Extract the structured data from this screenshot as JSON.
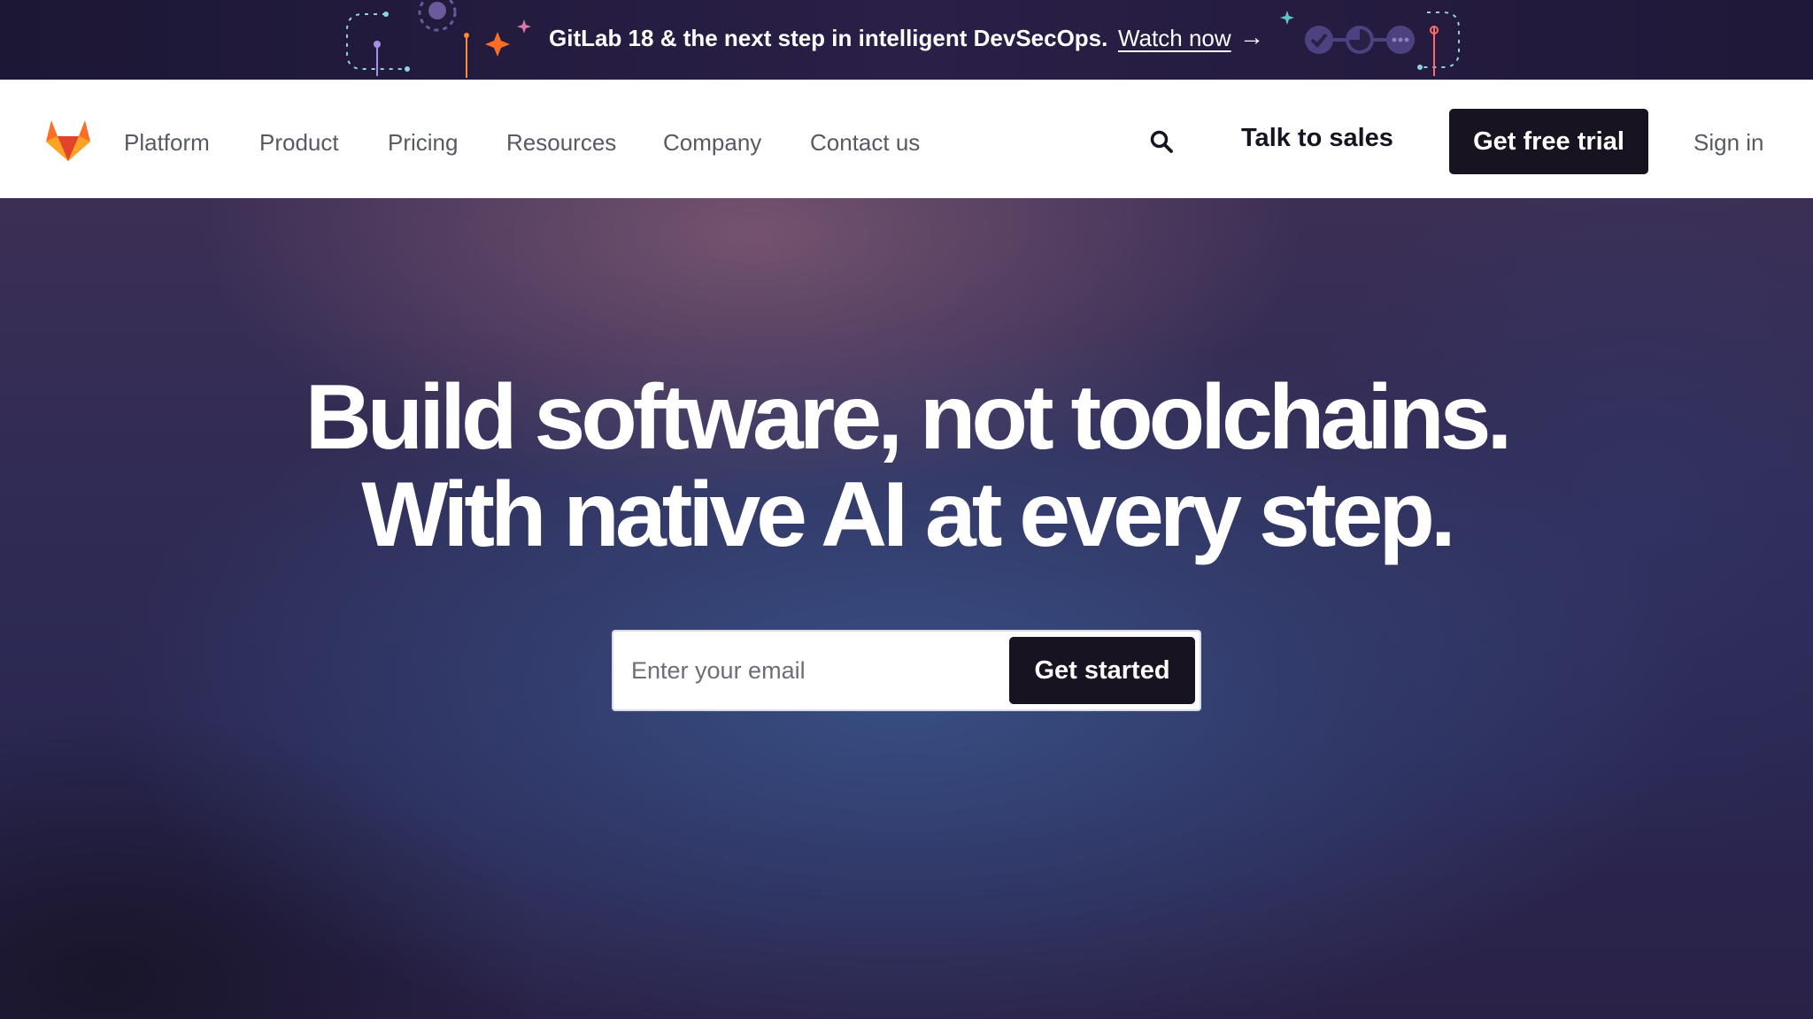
{
  "banner": {
    "message": "GitLab 18 & the next step in intelligent DevSecOps.",
    "link_label": "Watch now",
    "arrow": "→"
  },
  "nav": {
    "logo_icon": "gitlab-tanuki-logo-icon",
    "items": [
      {
        "label": "Platform"
      },
      {
        "label": "Product"
      },
      {
        "label": "Pricing"
      },
      {
        "label": "Resources"
      },
      {
        "label": "Company"
      },
      {
        "label": "Contact us"
      }
    ],
    "search_icon": "search-icon",
    "talk_to_sales": "Talk to sales",
    "free_trial": "Get free trial",
    "sign_in": "Sign in"
  },
  "hero": {
    "headline_line1": "Build software, not toolchains.",
    "headline_line2": "With native AI at every step.",
    "email_placeholder": "Enter your email",
    "email_value": "",
    "cta_label": "Get started"
  },
  "colors": {
    "banner_bg": "#221a3d",
    "nav_bg": "#ffffff",
    "button_dark": "#171321",
    "hero_accent": "#3a558c",
    "logo_orange": "#e24329"
  }
}
